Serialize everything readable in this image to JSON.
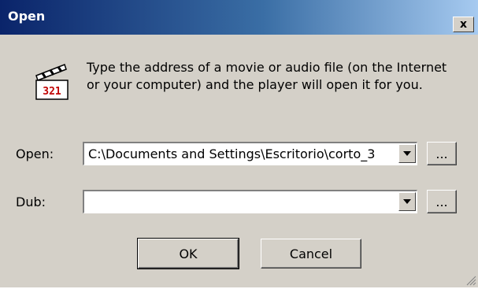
{
  "window": {
    "title": "Open",
    "close_glyph": "x"
  },
  "message": "Type the address of a movie or audio file (on the Internet or your computer) and the player will open it for you.",
  "icons": {
    "app": "clapperboard-321-icon",
    "close": "close-icon",
    "dropdown": "dropdown-arrow-icon",
    "grip": "resize-grip-icon"
  },
  "open_field": {
    "label": "Open:",
    "value": "C:\\Documents and Settings\\Escritorio\\corto_3",
    "browse_label": "..."
  },
  "dub_field": {
    "label": "Dub:",
    "value": "",
    "browse_label": "..."
  },
  "buttons": {
    "ok": "OK",
    "cancel": "Cancel"
  },
  "icon_badge": "321",
  "colors": {
    "title_start": "#0a246a",
    "title_end": "#a6caf0",
    "face": "#d4d0c8"
  }
}
